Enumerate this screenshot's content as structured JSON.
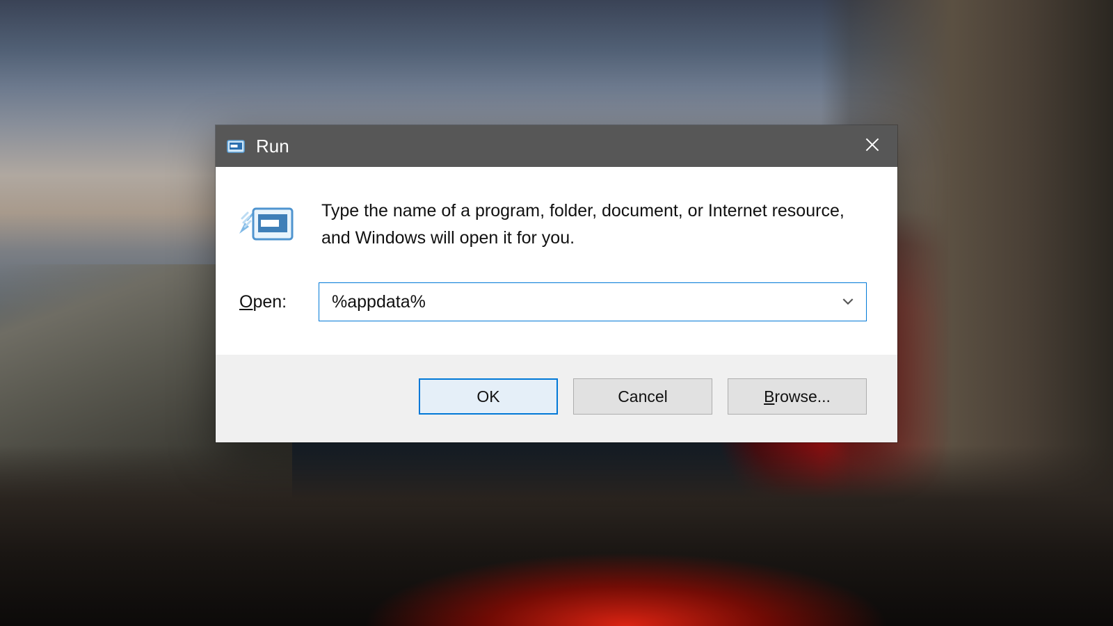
{
  "dialog": {
    "title": "Run",
    "description": "Type the name of a program, folder, document, or Internet resource, and Windows will open it for you.",
    "open_label_pre": "O",
    "open_label_accel": "",
    "open_label_full": "Open:",
    "input_value": "%appdata%",
    "buttons": {
      "ok": "OK",
      "cancel": "Cancel",
      "browse_accel": "B",
      "browse_rest": "rowse..."
    }
  },
  "icons": {
    "title_icon": "run-icon",
    "large_icon": "run-icon",
    "close": "close-icon",
    "chevron": "chevron-down-icon"
  },
  "colors": {
    "titlebar": "#575757",
    "accent": "#0078d7",
    "button_face": "#e1e1e1",
    "button_row_bg": "#f0f0f0"
  }
}
